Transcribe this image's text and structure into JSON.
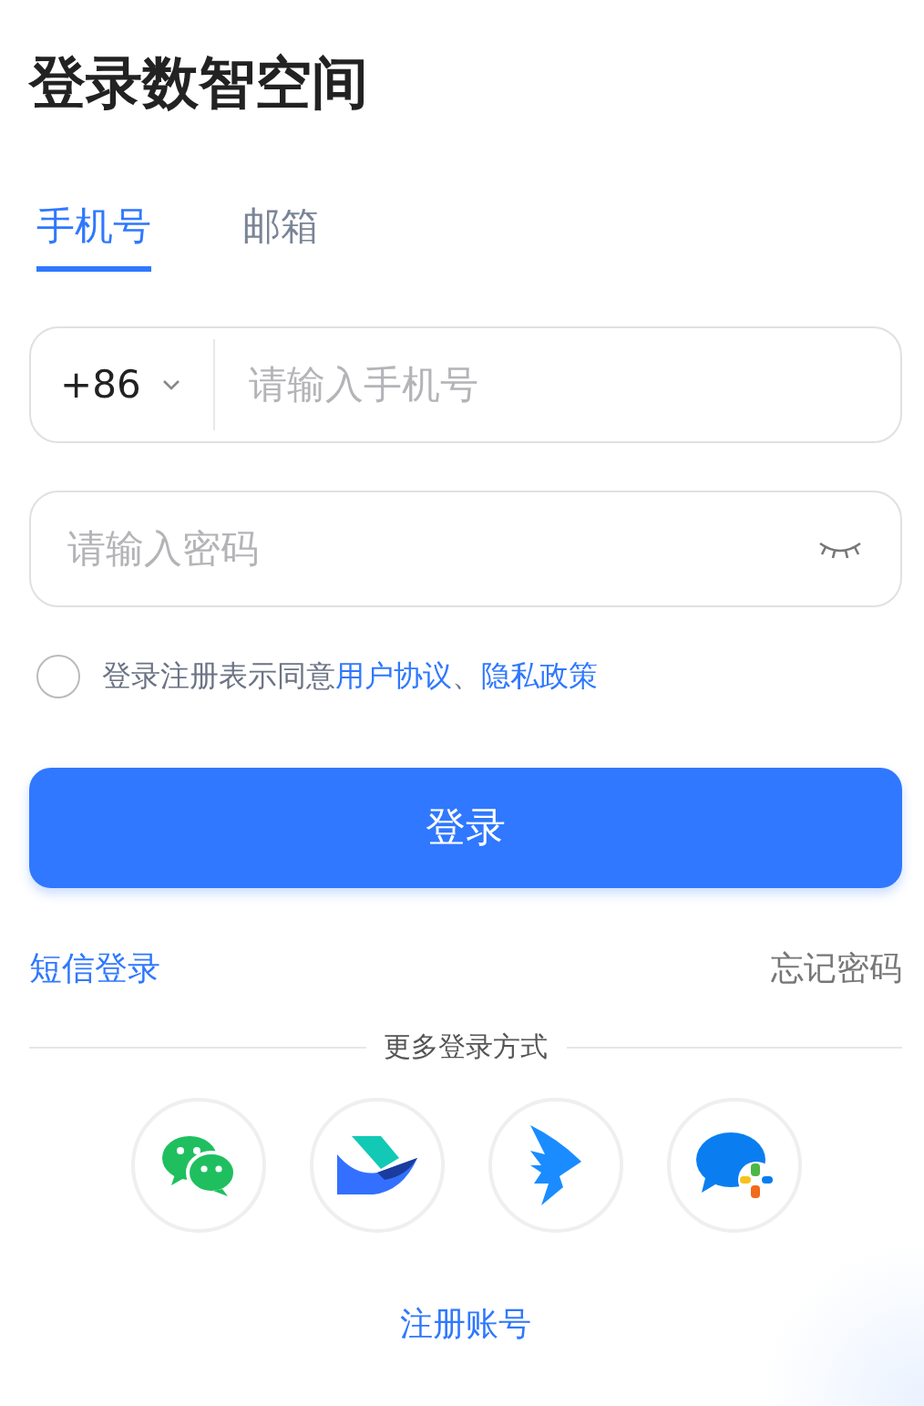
{
  "title": "登录数智空间",
  "tabs": [
    {
      "label": "手机号",
      "selected": true
    },
    {
      "label": "邮箱",
      "selected": false
    }
  ],
  "phone_field": {
    "country_code": "+86",
    "placeholder": "请输入手机号"
  },
  "password_field": {
    "placeholder": "请输入密码"
  },
  "agreement": {
    "checked": false,
    "text": "登录注册表示同意",
    "links": [
      "用户协议",
      "隐私政策"
    ],
    "separator": "、"
  },
  "login_button": "登录",
  "sms_login": "短信登录",
  "forgot_password": "忘记密码",
  "more_methods": "更多登录方式",
  "login_methods": [
    {
      "kind": "chat-bubbles"
    },
    {
      "kind": "bird"
    },
    {
      "kind": "wing"
    },
    {
      "kind": "bubble-pinwheel"
    }
  ],
  "register": "注册账号"
}
